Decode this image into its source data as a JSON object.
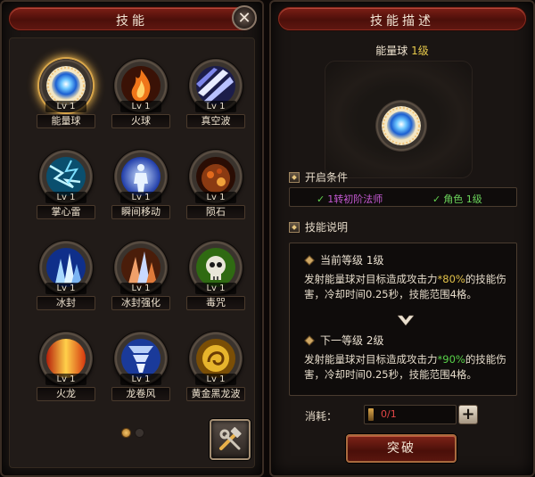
{
  "left_panel": {
    "title": "技能",
    "skills": [
      {
        "name": "能量球",
        "level": "Lv 1",
        "icon": "energy-orb-icon"
      },
      {
        "name": "火球",
        "level": "Lv 1",
        "icon": "fireball-icon"
      },
      {
        "name": "真空波",
        "level": "Lv 1",
        "icon": "vacuum-wave-icon"
      },
      {
        "name": "掌心雷",
        "level": "Lv 1",
        "icon": "palm-thunder-icon"
      },
      {
        "name": "瞬间移动",
        "level": "Lv 1",
        "icon": "teleport-icon"
      },
      {
        "name": "陨石",
        "level": "Lv 1",
        "icon": "meteor-icon"
      },
      {
        "name": "冰封",
        "level": "Lv 1",
        "icon": "ice-seal-icon"
      },
      {
        "name": "冰封强化",
        "level": "Lv 1",
        "icon": "ice-seal-enhance-icon"
      },
      {
        "name": "毒咒",
        "level": "Lv 1",
        "icon": "poison-curse-icon"
      },
      {
        "name": "火龙",
        "level": "Lv 1",
        "icon": "fire-dragon-icon"
      },
      {
        "name": "龙卷风",
        "level": "Lv 1",
        "icon": "tornado-icon"
      },
      {
        "name": "黄金黑龙波",
        "level": "Lv 1",
        "icon": "golden-dragon-wave-icon"
      }
    ],
    "selected_index": 0,
    "page_count": 2,
    "current_page": 1
  },
  "right_panel": {
    "title": "技能描述",
    "skill_name": "能量球",
    "skill_level": "1级",
    "unlock_heading": "开启条件",
    "conditions": [
      "1转初阶法师",
      "角色 1级"
    ],
    "explain_heading": "技能说明",
    "current": {
      "heading": "当前等级 1级",
      "text_before": "发射能量球对目标造成攻击力",
      "percent": "*80%",
      "text_after": "的技能伤害，冷却时间0.25秒，技能范围4格。"
    },
    "next": {
      "heading": "下一等级 2级",
      "text_before": "发射能量球对目标造成攻击力",
      "percent": "*90%",
      "text_after": "的技能伤害，冷却时间0.25秒，技能范围4格。"
    },
    "cost_label": "消耗：",
    "cost_value": "0/1",
    "break_button": "突破"
  },
  "colors": {
    "accent_red": "#7c1e15",
    "gold": "#e2c24a",
    "green": "#59d34a",
    "purple": "#c85ad6",
    "cost_red": "#e24646"
  }
}
